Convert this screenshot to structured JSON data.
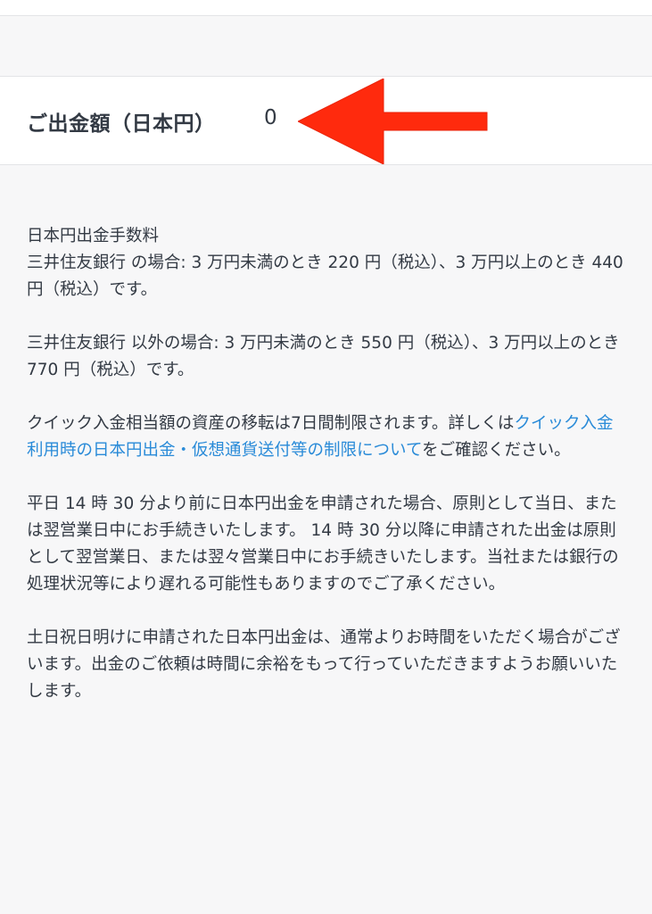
{
  "amount": {
    "label": "ご出金額（日本円）",
    "value": "0"
  },
  "fee_info": {
    "title": "日本円出金手数料",
    "smbc": "三井住友銀行 の場合: 3 万円未満のとき 220 円（税込）、3 万円以上のとき 440 円（税込）です。",
    "other_banks": "三井住友銀行 以外の場合: 3 万円未満のとき 550 円（税込）、3 万円以上のとき 770 円（税込）です。"
  },
  "quick_deposit": {
    "text_before": "クイック入金相当額の資産の移転は7日間制限されます。詳しくは",
    "link_text": "クイック入金利用時の日本円出金・仮想通貨送付等の制限について",
    "text_after": "をご確認ください。"
  },
  "processing_time": "平日 14 時 30 分より前に日本円出金を申請された場合、原則として当日、または翌営業日中にお手続きいたします。 14 時 30 分以降に申請された出金は原則として翌営業日、または翌々営業日中にお手続きいたします。当社または銀行の処理状況等により遅れる可能性もありますのでご了承ください。",
  "holiday_notice": "土日祝日明けに申請された日本円出金は、通常よりお時間をいただく場合がございます。出金のご依頼は時間に余裕をもって行っていただきますようお願いいたします。",
  "colors": {
    "arrow": "#ff2a0d",
    "link": "#2a8bd8",
    "text": "#333a44",
    "background": "#f7f7f8"
  }
}
